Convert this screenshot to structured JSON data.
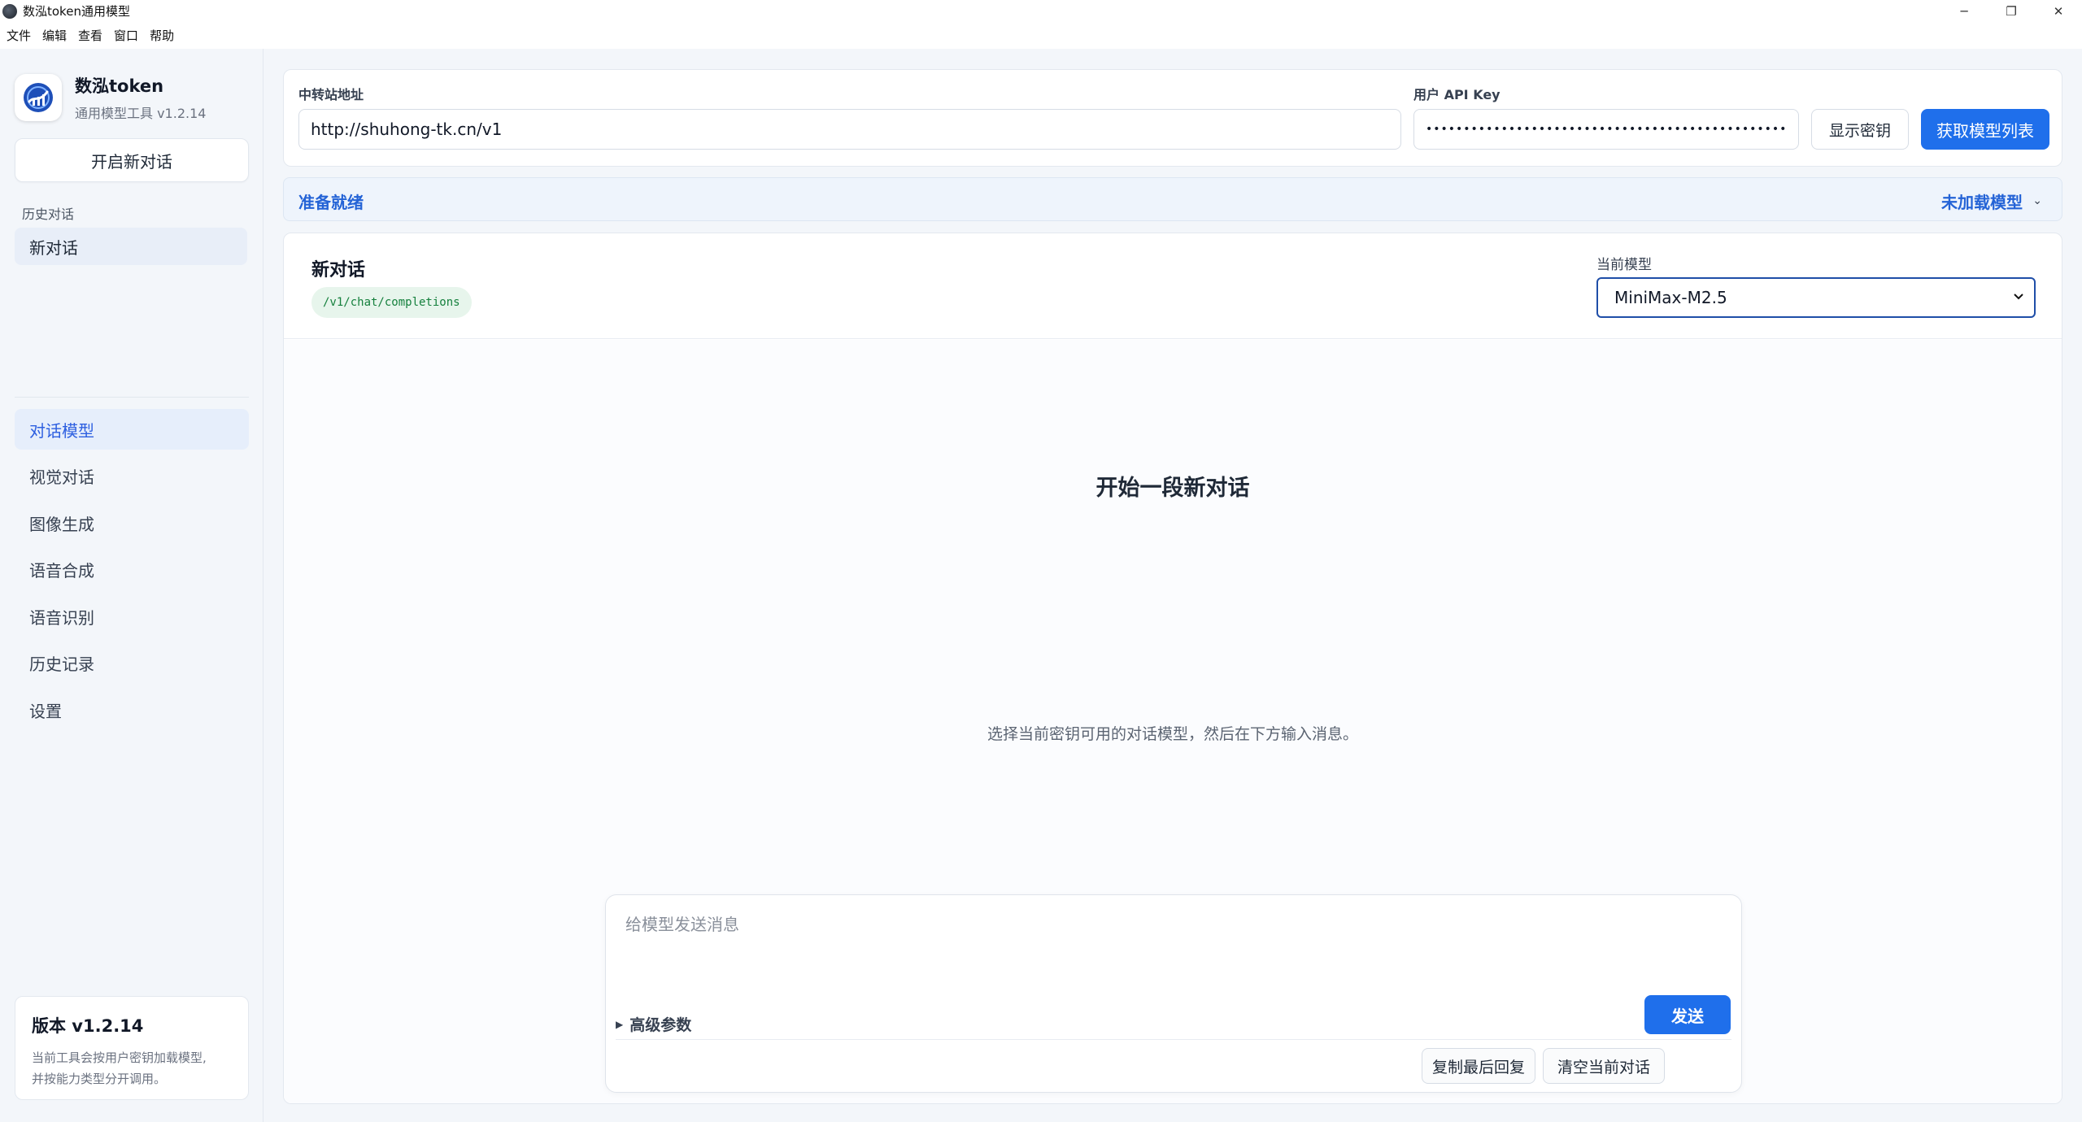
{
  "window": {
    "title": "数泓token通用模型",
    "minimize": "─",
    "restore": "❐",
    "close": "✕"
  },
  "menu": [
    "文件",
    "编辑",
    "查看",
    "窗口",
    "帮助"
  ],
  "sidebar": {
    "brand_name": "数泓token",
    "brand_sub": "通用模型工具 v1.2.14",
    "new_chat": "开启新对话",
    "history_heading": "历史对话",
    "history_items": [
      "新对话"
    ],
    "nav": [
      {
        "label": "对话模型",
        "active": true
      },
      {
        "label": "视觉对话",
        "active": false
      },
      {
        "label": "图像生成",
        "active": false
      },
      {
        "label": "语音合成",
        "active": false
      },
      {
        "label": "语音识别",
        "active": false
      },
      {
        "label": "历史记录",
        "active": false
      },
      {
        "label": "设置",
        "active": false
      }
    ],
    "version_title": "版本 v1.2.14",
    "version_desc_line1": "当前工具会按用户密钥加载模型,",
    "version_desc_line2": "并按能力类型分开调用。"
  },
  "config": {
    "relay_label": "中转站地址",
    "relay_value": "http://shuhong-tk.cn/v1",
    "key_label": "用户 API Key",
    "key_value": "••••••••••••••••••••••••••••••••••••••••••••••••••••",
    "show_key": "显示密钥",
    "fetch_models": "获取模型列表"
  },
  "status": {
    "left": "准备就绪",
    "right": "未加载模型",
    "chevron": "⌄"
  },
  "chat": {
    "title": "新对话",
    "endpoint": "/v1/chat/completions",
    "model_label": "当前模型",
    "model_selected": "MiniMax-M2.5",
    "empty_title": "开始一段新对话",
    "empty_sub": "选择当前密钥可用的对话模型，然后在下方输入消息。",
    "composer_placeholder": "给模型发送消息",
    "advanced": "高级参数",
    "send": "发送",
    "copy_last": "复制最后回复",
    "clear": "清空当前对话"
  },
  "colors": {
    "accent": "#1f6feb",
    "status_text": "#2463d6",
    "badge_bg": "#e7f5ec",
    "badge_text": "#15803d"
  }
}
